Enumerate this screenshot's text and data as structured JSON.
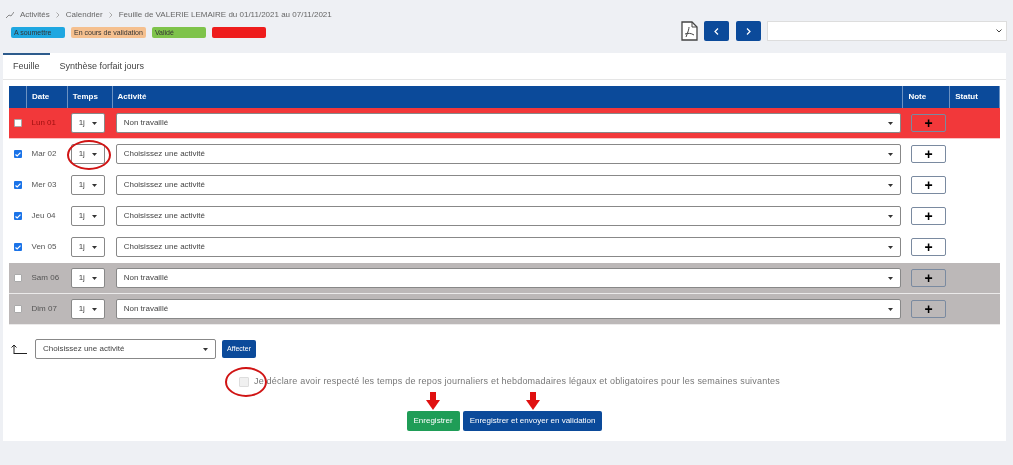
{
  "breadcrumb": [
    "Activités",
    "Calendrier",
    "Feuille de VALERIE LEMAIRE du 01/11/2021 au 07/11/2021"
  ],
  "legend": [
    {
      "label": "A soumettre",
      "color": "#1ea7e1"
    },
    {
      "label": "En cours de validation",
      "color": "#f5c08f"
    },
    {
      "label": "Validé",
      "color": "#7ec34a"
    },
    {
      "color": "#ee1c1c"
    }
  ],
  "tabs": [
    {
      "label": "Feuille",
      "selected": true
    },
    {
      "label": "Synthèse forfait jours",
      "selected": false
    }
  ],
  "table": {
    "columns": [
      "Date",
      "Temps",
      "Activité",
      "Note",
      "Statut"
    ],
    "rows": [
      {
        "kind": "refused",
        "checked": false,
        "date": "Lun 01",
        "temps": "1j",
        "activity": "Non travaillé",
        "note": "+",
        "circled": false
      },
      {
        "kind": "open",
        "checked": true,
        "date": "Mar 02",
        "temps": "1j",
        "activity": "Choisissez une activité",
        "note": "+",
        "circled": true
      },
      {
        "kind": "open",
        "checked": true,
        "date": "Mer 03",
        "temps": "1j",
        "activity": "Choisissez une activité",
        "note": "+",
        "circled": false
      },
      {
        "kind": "open",
        "checked": true,
        "date": "Jeu 04",
        "temps": "1j",
        "activity": "Choisissez une activité",
        "note": "+",
        "circled": false
      },
      {
        "kind": "open",
        "checked": true,
        "date": "Ven 05",
        "temps": "1j",
        "activity": "Choisissez une activité",
        "note": "+",
        "circled": false
      },
      {
        "kind": "weekend",
        "checked": false,
        "date": "Sam 06",
        "temps": "1j",
        "activity": "Non travaillé",
        "note": "+",
        "circled": false
      },
      {
        "kind": "weekend",
        "checked": false,
        "date": "Dim 07",
        "temps": "1j",
        "activity": "Non travaillé",
        "note": "+",
        "circled": false
      }
    ]
  },
  "assign": {
    "activity": "Choisissez une activité",
    "button": "Affecter"
  },
  "declaration": {
    "text": "Je déclare avoir respecté les temps de repos journaliers et hebdomadaires légaux et obligatoires pour les semaines suivantes",
    "checked": false,
    "circled": true
  },
  "buttons": [
    {
      "label": "Enregistrer",
      "kind": "success",
      "arrow": true
    },
    {
      "label": "Enregistrer et envoyer en validation",
      "kind": "primary",
      "arrow": true
    }
  ]
}
